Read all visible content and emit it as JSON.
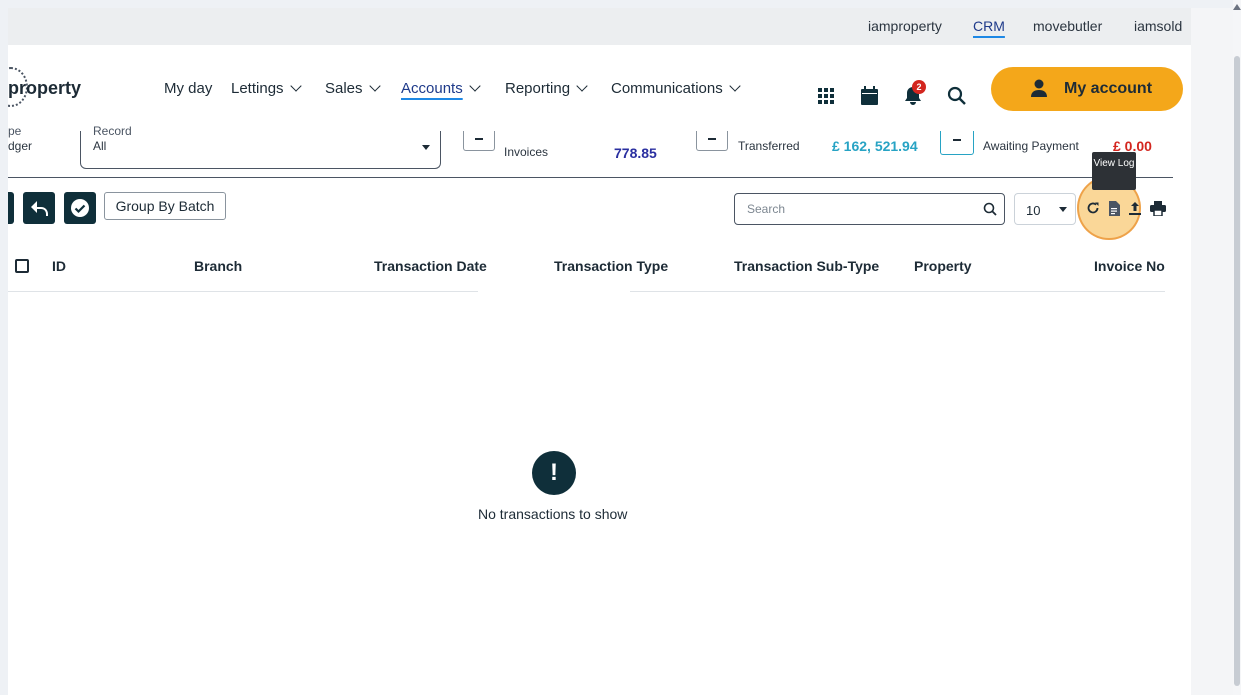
{
  "top_links": [
    {
      "label": "iamproperty",
      "active": false
    },
    {
      "label": "CRM",
      "active": true
    },
    {
      "label": "movebutler",
      "active": false
    },
    {
      "label": "iamsold",
      "active": false
    }
  ],
  "logo": {
    "text": "property"
  },
  "nav": [
    {
      "label": "My day",
      "has_dropdown": false
    },
    {
      "label": "Lettings",
      "has_dropdown": true
    },
    {
      "label": "Sales",
      "has_dropdown": true
    },
    {
      "label": "Accounts",
      "has_dropdown": true,
      "active": true
    },
    {
      "label": "Reporting",
      "has_dropdown": true
    },
    {
      "label": "Communications",
      "has_dropdown": true
    }
  ],
  "header_icons": [
    "grid-icon",
    "calendar-icon",
    "bell-icon",
    "search-icon"
  ],
  "notifications_count": "2",
  "my_account_label": "My account",
  "summary": {
    "type_label_partial": "pe",
    "type_value_partial": "dger",
    "record_label_partial": "Record",
    "record_value": "All",
    "invoices_label": "Invoices",
    "invoices_amount": "778.85",
    "transferred_label": "Transferred",
    "transferred_amount": "£ 162, 521.94",
    "awaiting_label": "Awaiting Payment",
    "awaiting_amount": "£ 0.00"
  },
  "colors": {
    "accent": "#f4a71a",
    "dark": "#0f2f3a",
    "transferred": "#27a3c4",
    "awaiting": "#d3261f",
    "invoices": "#2a2fa0"
  },
  "toolbar": {
    "group_by_batch_label": "Group By Batch",
    "search_placeholder": "Search",
    "page_size": "10",
    "tooltip": "View Log",
    "tools": [
      "refresh-icon",
      "document-icon",
      "upload-icon",
      "print-icon"
    ]
  },
  "table": {
    "columns": [
      "ID",
      "Branch",
      "Transaction Date",
      "Transaction Type",
      "Transaction Sub-Type",
      "Property",
      "Invoice No"
    ],
    "empty_message": "No transactions to show",
    "empty_icon_glyph": "!"
  }
}
